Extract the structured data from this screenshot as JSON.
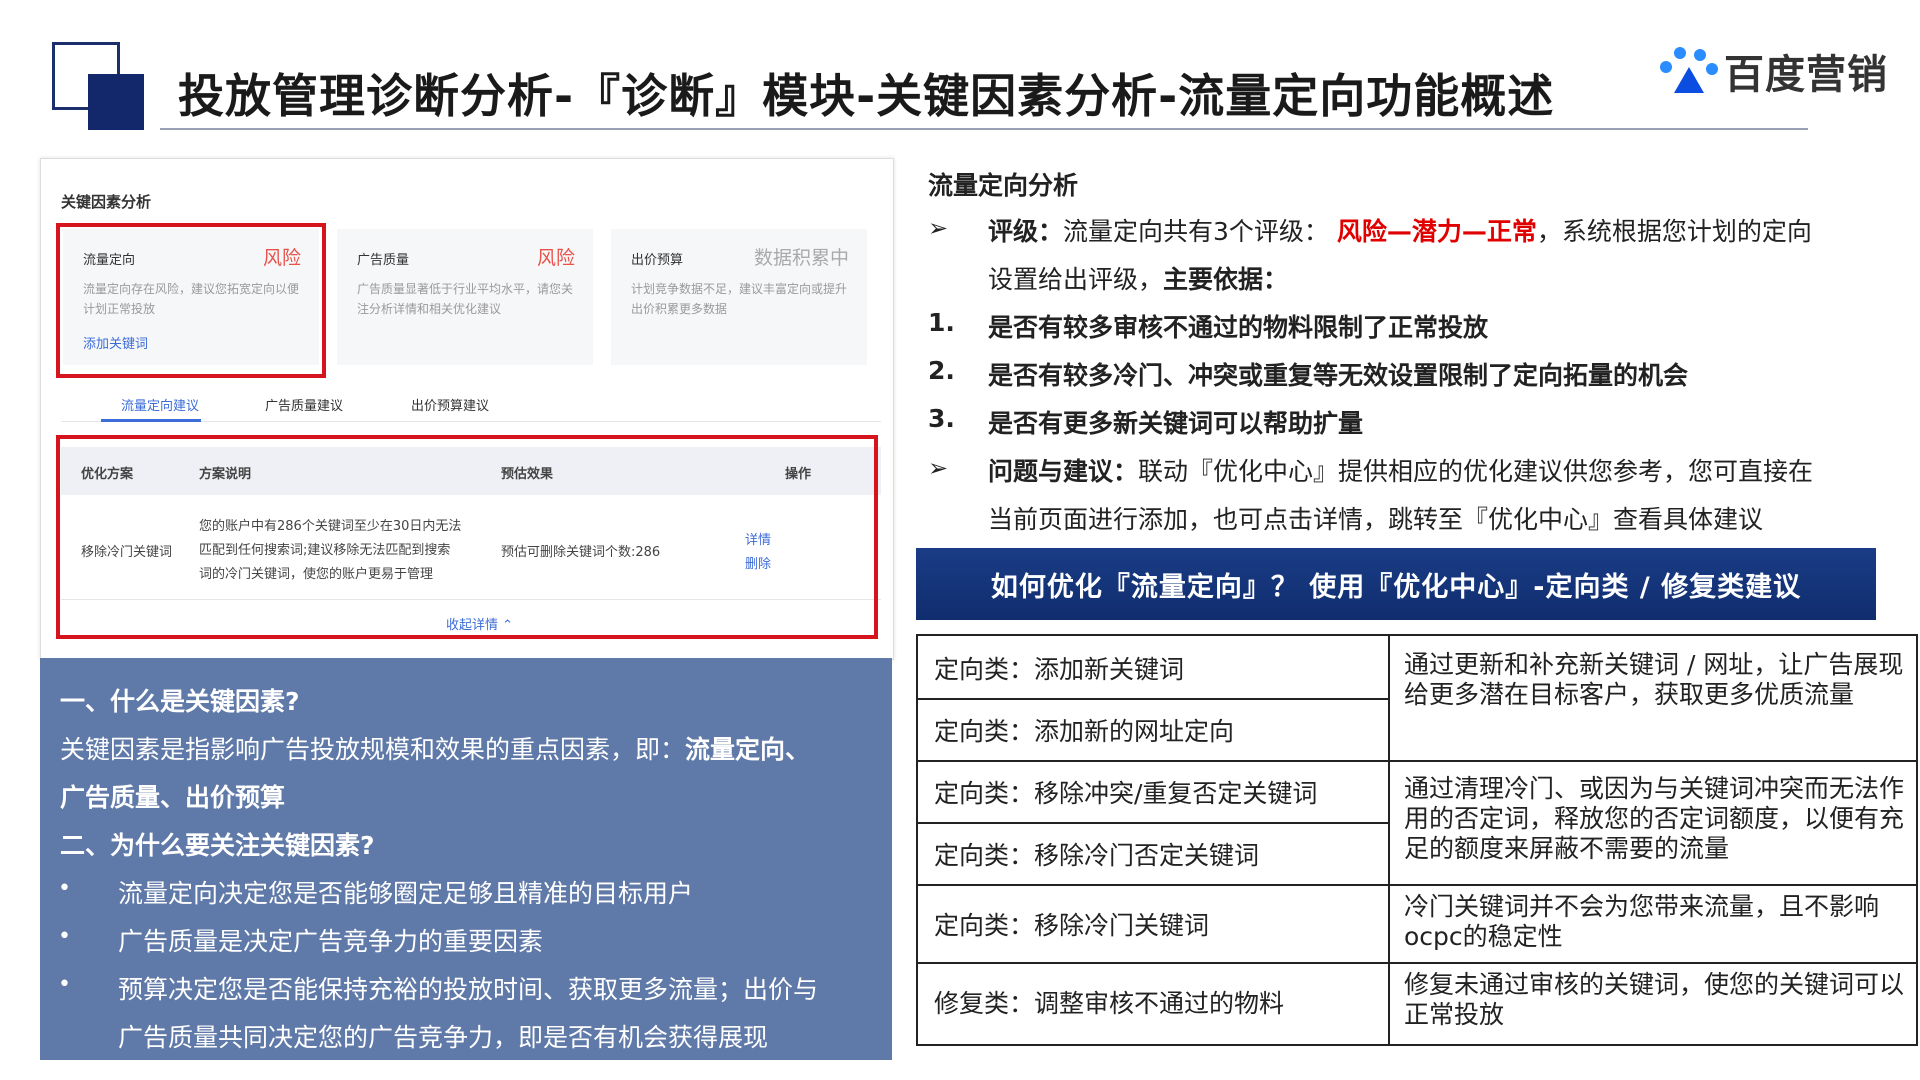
{
  "header": {
    "title": "投放管理诊断分析-『诊断』模块-关键因素分析-流量定向功能概述",
    "brand": "百度营销"
  },
  "screenshot": {
    "section_title": "关键因素分析",
    "cards": [
      {
        "title": "流量定向",
        "status": "风险",
        "desc": "流量定向存在风险，建议您拓宽定向以便计划正常投放",
        "link": "添加关键词"
      },
      {
        "title": "广告质量",
        "status": "风险",
        "desc": "广告质量显著低于行业平均水平，请您关注分析详情和相关优化建议",
        "link": ""
      },
      {
        "title": "出价预算",
        "status": "数据积累中",
        "desc": "计划竞争数据不足，建议丰富定向或提升出价积累更多数据",
        "link": ""
      }
    ],
    "tabs": [
      "流量定向建议",
      "广告质量建议",
      "出价预算建议"
    ],
    "table_headers": [
      "优化方案",
      "方案说明",
      "预估效果",
      "操作"
    ],
    "table_row": {
      "plan": "移除冷门关键词",
      "desc_lines": [
        "您的账户中有286个关键词至少在30日内无法",
        "匹配到任何搜索词;建议移除无法匹配到搜索",
        "词的冷门关键词，使您的账户更易于管理"
      ],
      "effect": "预估可删除关键词个数:286",
      "actions": [
        "详情",
        "删除"
      ]
    },
    "collapse": "收起详情 ⌃"
  },
  "info": {
    "h1": "一、什么是关键因素?",
    "p1a": "关键因素是指影响广告投放规模和效果的重点因素，即：",
    "p1b": "流量定向、",
    "p1c": "广告质量、出价预算",
    "h2": "二、为什么要关注关键因素?",
    "bullets": [
      "流量定向决定您是否能够圈定足够且精准的目标用户",
      "广告质量是决定广告竞争力的重要因素",
      "预算决定您是否能保持充裕的投放时间、获取更多流量；出价与",
      "广告质量共同决定您的广告竞争力，即是否有机会获得展现"
    ]
  },
  "right": {
    "heading": "流量定向分析",
    "rating_label": "评级：",
    "rating_text": "流量定向共有3个评级：",
    "rating_levels": "风险—潜力—正常",
    "rating_rest": "，系统根据您计划的定向",
    "rating_line2a": "设置给出评级，",
    "rating_line2b": "主要依据：",
    "points": [
      {
        "num": "1.",
        "text": "是否有较多审核不通过的物料限制了正常投放"
      },
      {
        "num": "2.",
        "text": "是否有较多冷门、冲突或重复等无效设置限制了定向拓量的机会"
      },
      {
        "num": "3.",
        "text": "是否有更多新关键词可以帮助扩量"
      }
    ],
    "issue_label": "问题与建议：",
    "issue_text": "联动『优化中心』提供相应的优化建议供您参考，您可直接在",
    "issue_line2": "当前页面进行添加，也可点击详情，跳转至『优化中心』查看具体建议",
    "banner": "如何优化『流量定向』？ 使用『优化中心』-定向类 / 修复类建议",
    "table": {
      "left": [
        "定向类：添加新关键词",
        "定向类：添加新的网址定向",
        "定向类：移除冲突/重复否定关键词",
        "定向类：移除冷门否定关键词",
        "定向类：移除冷门关键词",
        "修复类：调整审核不通过的物料"
      ],
      "right": [
        "通过更新和补充新关键词 / 网址，让广告展现给更多潜在目标客户，获取更多优质流量",
        "通过清理冷门、或因为与关键词冲突而无法作用的否定词，释放您的否定词额度，以便有充足的额度来屏蔽不需要的流量",
        "冷门关键词并不会为您带来流量，且不影响ocpc的稳定性",
        "修复未通过审核的关键词，使您的关键词可以正常投放"
      ]
    }
  }
}
